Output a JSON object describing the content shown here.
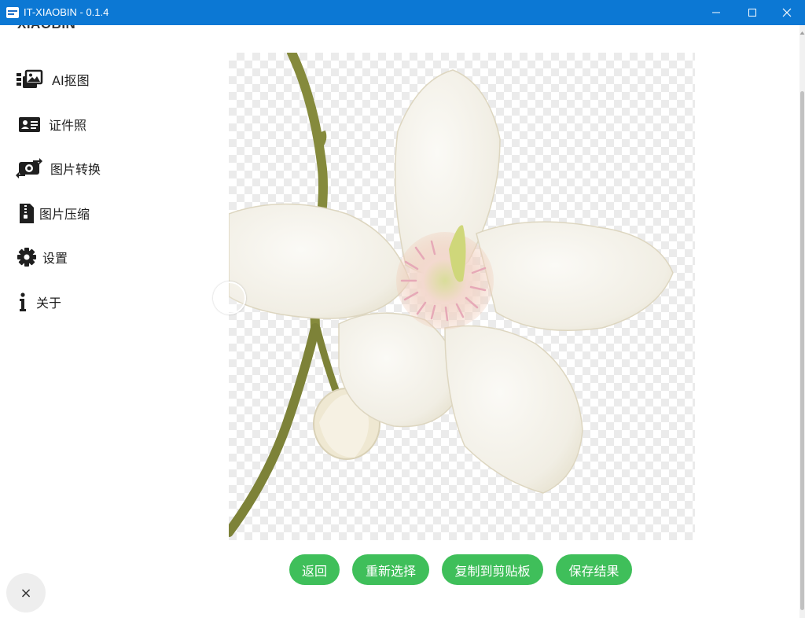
{
  "window": {
    "title": "IT-XIAOBIN - 0.1.4"
  },
  "logo": {
    "text": "XIAOBIN"
  },
  "sidebar": {
    "items": [
      {
        "label": "AI抠图",
        "icon": "image-cutout-icon"
      },
      {
        "label": "证件照",
        "icon": "id-card-icon"
      },
      {
        "label": "图片转换",
        "icon": "image-convert-icon"
      },
      {
        "label": "图片压缩",
        "icon": "zip-file-icon"
      },
      {
        "label": "设置",
        "icon": "gear-icon"
      },
      {
        "label": "关于",
        "icon": "info-icon"
      }
    ]
  },
  "actions": {
    "back": "返回",
    "reselect": "重新选择",
    "copy": "复制到剪贴板",
    "save": "保存结果"
  },
  "fab": {
    "label": "×",
    "icon": "close-icon"
  },
  "colors": {
    "titlebar": "#0c78d4",
    "accent_button": "#3fbf5a"
  }
}
